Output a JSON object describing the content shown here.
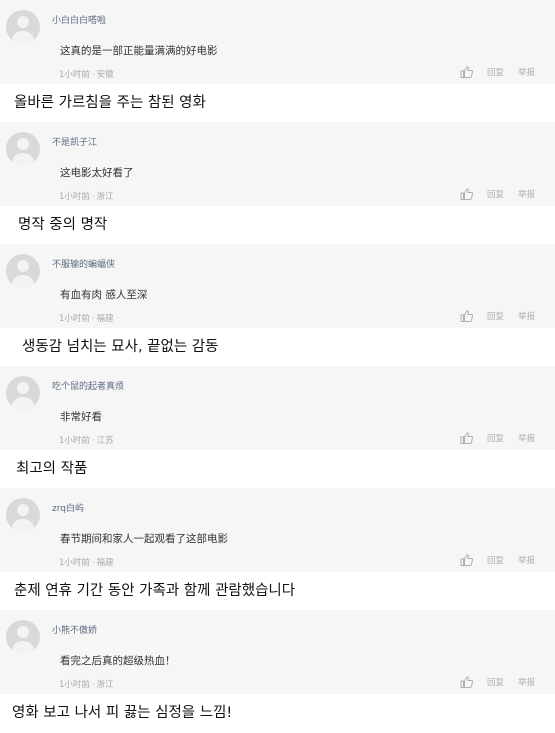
{
  "comments": [
    {
      "username": "小白白白嗒啦",
      "text": "这真的是一部正能量满满的好电影",
      "time": "1小时前",
      "separator": "·",
      "location": "安徽",
      "reply_label": "回复",
      "report_label": "举报",
      "caption": "올바른 가르침을 주는 참된 영화"
    },
    {
      "username": "不是凯子江",
      "text": "这电影太好看了",
      "time": "1小时前",
      "separator": "·",
      "location": "浙江",
      "reply_label": "回复",
      "report_label": "举报",
      "caption": "명작 중의 명작"
    },
    {
      "username": "不服输的蝙蝠侠",
      "text": "有血有肉 感人至深",
      "time": "1小时前",
      "separator": "·",
      "location": "福建",
      "reply_label": "回复",
      "report_label": "举报",
      "caption": "생동감 넘치는 묘사, 끝없는 감동"
    },
    {
      "username": "吃个鼠的起者真烦",
      "text": "非常好看",
      "time": "1小时前",
      "separator": "·",
      "location": "江苏",
      "reply_label": "回复",
      "report_label": "举报",
      "caption": "최고의 작품"
    },
    {
      "username": "zrq白屿",
      "text": "春节期间和家人一起观看了这部电影",
      "time": "1小时前",
      "separator": "·",
      "location": "福建",
      "reply_label": "回复",
      "report_label": "举报",
      "caption": "춘제 연휴 기간 동안 가족과 함께 관람했습니다"
    },
    {
      "username": "小熊不傲娇",
      "text": "看完之后真的超级热血！",
      "time": "1小时前",
      "separator": "·",
      "location": "浙江",
      "reply_label": "回复",
      "report_label": "举报",
      "caption": "영화 보고 나서 피 끓는 심정을 느낌!"
    }
  ],
  "colors": {
    "comment_bg": "#f6f6f6",
    "username": "#5b6a80",
    "meta": "#a9a9a9"
  }
}
